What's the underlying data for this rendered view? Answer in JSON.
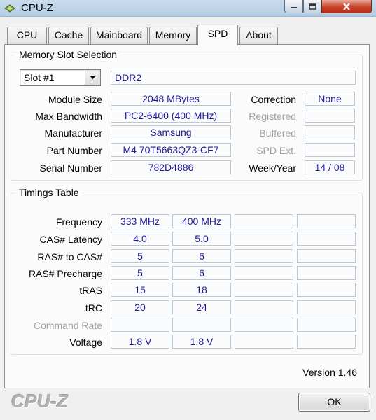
{
  "window": {
    "title": "CPU-Z",
    "close_color": "#c8432b"
  },
  "tabs": [
    {
      "label": "CPU"
    },
    {
      "label": "Cache"
    },
    {
      "label": "Mainboard"
    },
    {
      "label": "Memory"
    },
    {
      "label": "SPD",
      "active": true
    },
    {
      "label": "About"
    }
  ],
  "slot": {
    "group_title": "Memory Slot Selection",
    "selected": "Slot #1",
    "type": "DDR2"
  },
  "module": {
    "labels": {
      "size": "Module Size",
      "bandwidth": "Max Bandwidth",
      "manufacturer": "Manufacturer",
      "part": "Part Number",
      "serial": "Serial Number",
      "correction": "Correction",
      "registered": "Registered",
      "buffered": "Buffered",
      "spd_ext": "SPD Ext.",
      "week_year": "Week/Year"
    },
    "values": {
      "size": "2048 MBytes",
      "bandwidth": "PC2-6400 (400 MHz)",
      "manufacturer": "Samsung",
      "part": "M4 70T5663QZ3-CF7",
      "serial": "782D4886",
      "correction": "None",
      "registered": "",
      "buffered": "",
      "spd_ext": "",
      "week_year": "14 / 08"
    }
  },
  "timings": {
    "group_title": "Timings Table",
    "rows": [
      {
        "label": "Frequency",
        "values": [
          "333 MHz",
          "400 MHz",
          "",
          ""
        ]
      },
      {
        "label": "CAS# Latency",
        "values": [
          "4.0",
          "5.0",
          "",
          ""
        ]
      },
      {
        "label": "RAS# to CAS#",
        "values": [
          "5",
          "6",
          "",
          ""
        ]
      },
      {
        "label": "RAS# Precharge",
        "values": [
          "5",
          "6",
          "",
          ""
        ]
      },
      {
        "label": "tRAS",
        "values": [
          "15",
          "18",
          "",
          ""
        ]
      },
      {
        "label": "tRC",
        "values": [
          "20",
          "24",
          "",
          ""
        ]
      },
      {
        "label": "Command Rate",
        "values": [
          "",
          "",
          "",
          ""
        ],
        "disabled": true
      },
      {
        "label": "Voltage",
        "values": [
          "1.8 V",
          "1.8 V",
          "",
          ""
        ]
      }
    ]
  },
  "footer": {
    "logo": "CPU-Z",
    "version": "Version 1.46",
    "ok_label": "OK"
  },
  "value_text_color": "#1c1a9a"
}
